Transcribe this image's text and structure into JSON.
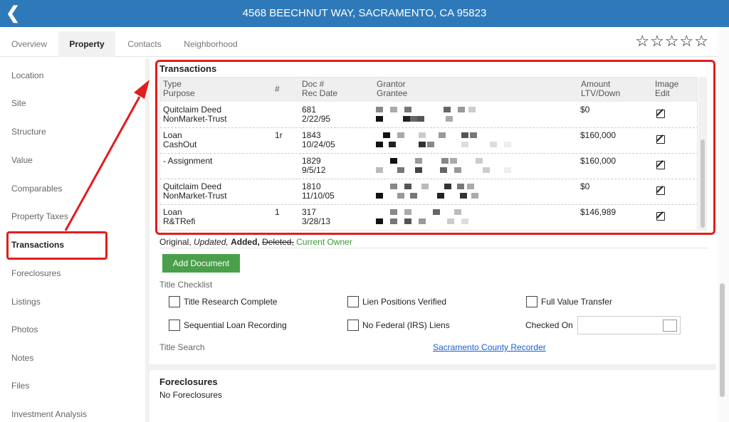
{
  "header": {
    "back_icon": "chevron-left-icon",
    "title": "4568 BEECHNUT WAY, SACRAMENTO, CA 95823"
  },
  "tabs": [
    "Overview",
    "Property",
    "Contacts",
    "Neighborhood"
  ],
  "rating": {
    "stars_filled": 0,
    "stars_total": 5
  },
  "sidebar": [
    "Location",
    "Site",
    "Structure",
    "Value",
    "Comparables",
    "Property Taxes",
    "Transactions",
    "Foreclosures",
    "Listings",
    "Photos",
    "Notes",
    "Files",
    "Investment Analysis"
  ],
  "transactions": {
    "title": "Transactions",
    "headers": {
      "type": "Type",
      "purpose": "Purpose",
      "num": "#",
      "doc": "Doc #",
      "rec_date": "Rec Date",
      "grantor": "Grantor",
      "grantee": "Grantee",
      "amount": "Amount",
      "ltv": "LTV/Down",
      "image": "Image",
      "edit": "Edit"
    },
    "rows": [
      {
        "type": "Quitclaim Deed",
        "purpose": "NonMarket-Trust",
        "num": "",
        "doc": "681",
        "date": "2/22/95",
        "amount": "$0"
      },
      {
        "type": "Loan",
        "purpose": "CashOut",
        "num": "1r",
        "doc": "1843",
        "date": "10/24/05",
        "amount": "$160,000"
      },
      {
        "type": "- Assignment",
        "purpose": "",
        "num": "",
        "doc": "1829",
        "date": "9/5/12",
        "amount": "$160,000"
      },
      {
        "type": "Quitclaim Deed",
        "purpose": "NonMarket-Trust",
        "num": "",
        "doc": "1810",
        "date": "11/10/05",
        "amount": "$0"
      },
      {
        "type": "Loan",
        "purpose": "R&TRefi",
        "num": "1",
        "doc": "317",
        "date": "3/28/13",
        "amount": "$146,989"
      }
    ]
  },
  "legend": {
    "original": "Original,",
    "updated": "Updated,",
    "added": "Added,",
    "deleted": "Deleted,",
    "current": "Current Owner"
  },
  "add_document": "Add Document",
  "title_checklist": {
    "label": "Title Checklist",
    "items": [
      "Title Research Complete",
      "Lien Positions Verified",
      "Full Value Transfer",
      "Sequential Loan Recording",
      "No Federal (IRS) Liens"
    ],
    "checked_on_label": "Checked On"
  },
  "title_search": {
    "label": "Title Search",
    "link": "Sacramento County Recorder"
  },
  "foreclosures": {
    "title": "Foreclosures",
    "text": "No Foreclosures"
  },
  "colors": {
    "header": "#2e79b9",
    "highlight": "#e21d1d",
    "button": "#4a9f4b",
    "current_owner": "#3a9a37",
    "link": "#1a5fd0"
  }
}
